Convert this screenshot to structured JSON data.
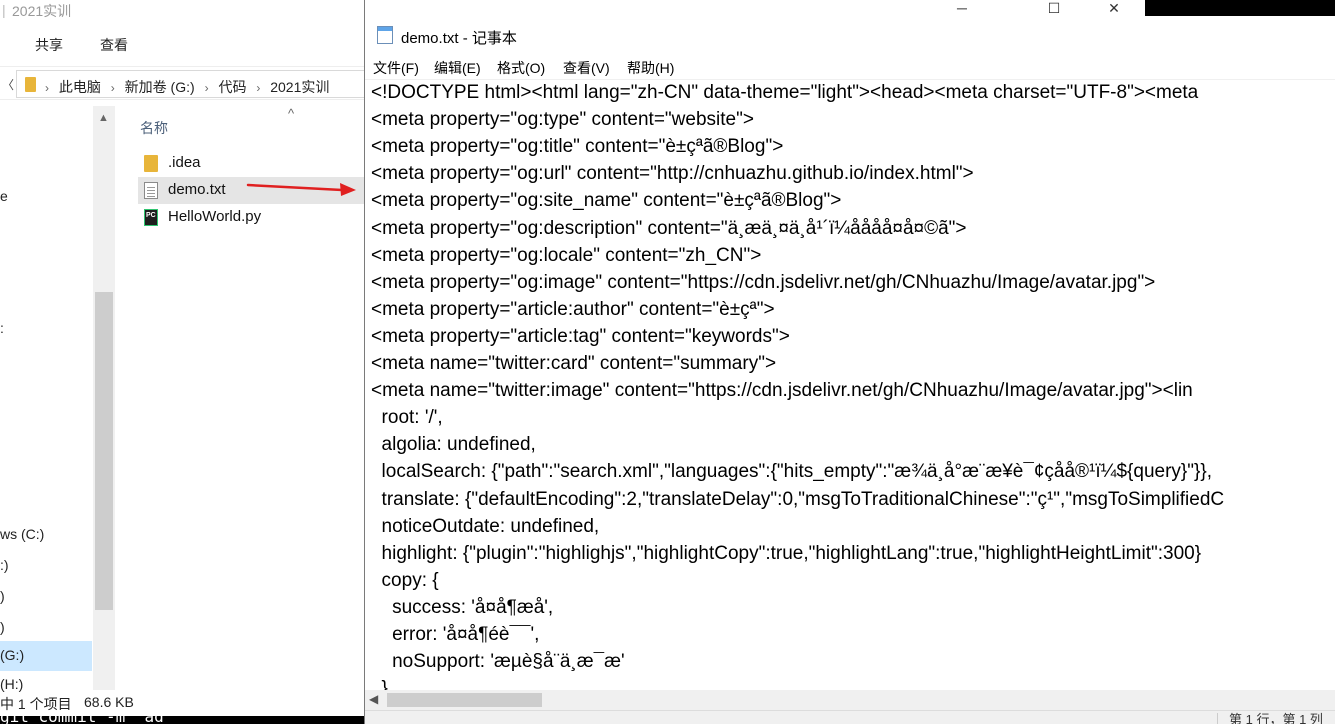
{
  "explorer": {
    "title": "2021实训",
    "ribbon": {
      "tab_share": "共享",
      "tab_view": "查看"
    },
    "breadcrumb": [
      "此电脑",
      "新加卷 (G:)",
      "代码",
      "2021实训"
    ],
    "nav_fragments": [
      "e",
      "ws (C:)",
      ":)",
      ")",
      ")",
      "(G:)",
      "(H:)"
    ],
    "column_name": "名称",
    "files": [
      {
        "name": ".idea",
        "icon": "folder-icon"
      },
      {
        "name": "demo.txt",
        "icon": "text-file-icon"
      },
      {
        "name": "HelloWorld.py",
        "icon": "pycharm-file-icon"
      }
    ],
    "status": {
      "selection": "中 1 个项目",
      "size": "68.6 KB"
    },
    "terminal_text": "git commit -m \"ad"
  },
  "notepad": {
    "title": "demo.txt - 记事本",
    "menu": {
      "file": "文件(F)",
      "edit": "编辑(E)",
      "format": "格式(O)",
      "view": "查看(V)",
      "help": "帮助(H)"
    },
    "lines": [
      "<!DOCTYPE html><html lang=\"zh-CN\" data-theme=\"light\"><head><meta charset=\"UTF-8\"><meta",
      "<meta property=\"og:type\" content=\"website\">",
      "<meta property=\"og:title\" content=\"è±çªã®Blog\">",
      "<meta property=\"og:url\" content=\"http://cnhuazhu.github.io/index.html\">",
      "<meta property=\"og:site_name\" content=\"è±çªã®Blog\">",
      "<meta property=\"og:description\" content=\"ä¸æä¸¤ä¸å¹´ï¼åååå¤å¤©ã\">",
      "<meta property=\"og:locale\" content=\"zh_CN\">",
      "<meta property=\"og:image\" content=\"https://cdn.jsdelivr.net/gh/CNhuazhu/Image/avatar.jpg\">",
      "<meta property=\"article:author\" content=\"è±çª\">",
      "<meta property=\"article:tag\" content=\"keywords\">",
      "<meta name=\"twitter:card\" content=\"summary\">",
      "<meta name=\"twitter:image\" content=\"https://cdn.jsdelivr.net/gh/CNhuazhu/Image/avatar.jpg\"><lin",
      "  root: '/',",
      "  algolia: undefined,",
      "  localSearch: {\"path\":\"search.xml\",\"languages\":{\"hits_empty\":\"æ¾ä¸å°æ¨æ¥è¯¢çåå®¹ï¼${query}\"}},",
      "  translate: {\"defaultEncoding\":2,\"translateDelay\":0,\"msgToTraditionalChinese\":\"ç¹\",\"msgToSimplifiedC",
      "  noticeOutdate: undefined,",
      "  highlight: {\"plugin\":\"highlighjs\",\"highlightCopy\":true,\"highlightLang\":true,\"highlightHeightLimit\":300}",
      "  copy: {",
      "    success: 'å¤å¶æå',",
      "    error: 'å¤å¶éè¯¯',",
      "    noSupport: 'æµè§å¨ä¸æ¯æ'",
      "  }"
    ],
    "status_position": "第 1 行，第 1 列"
  }
}
